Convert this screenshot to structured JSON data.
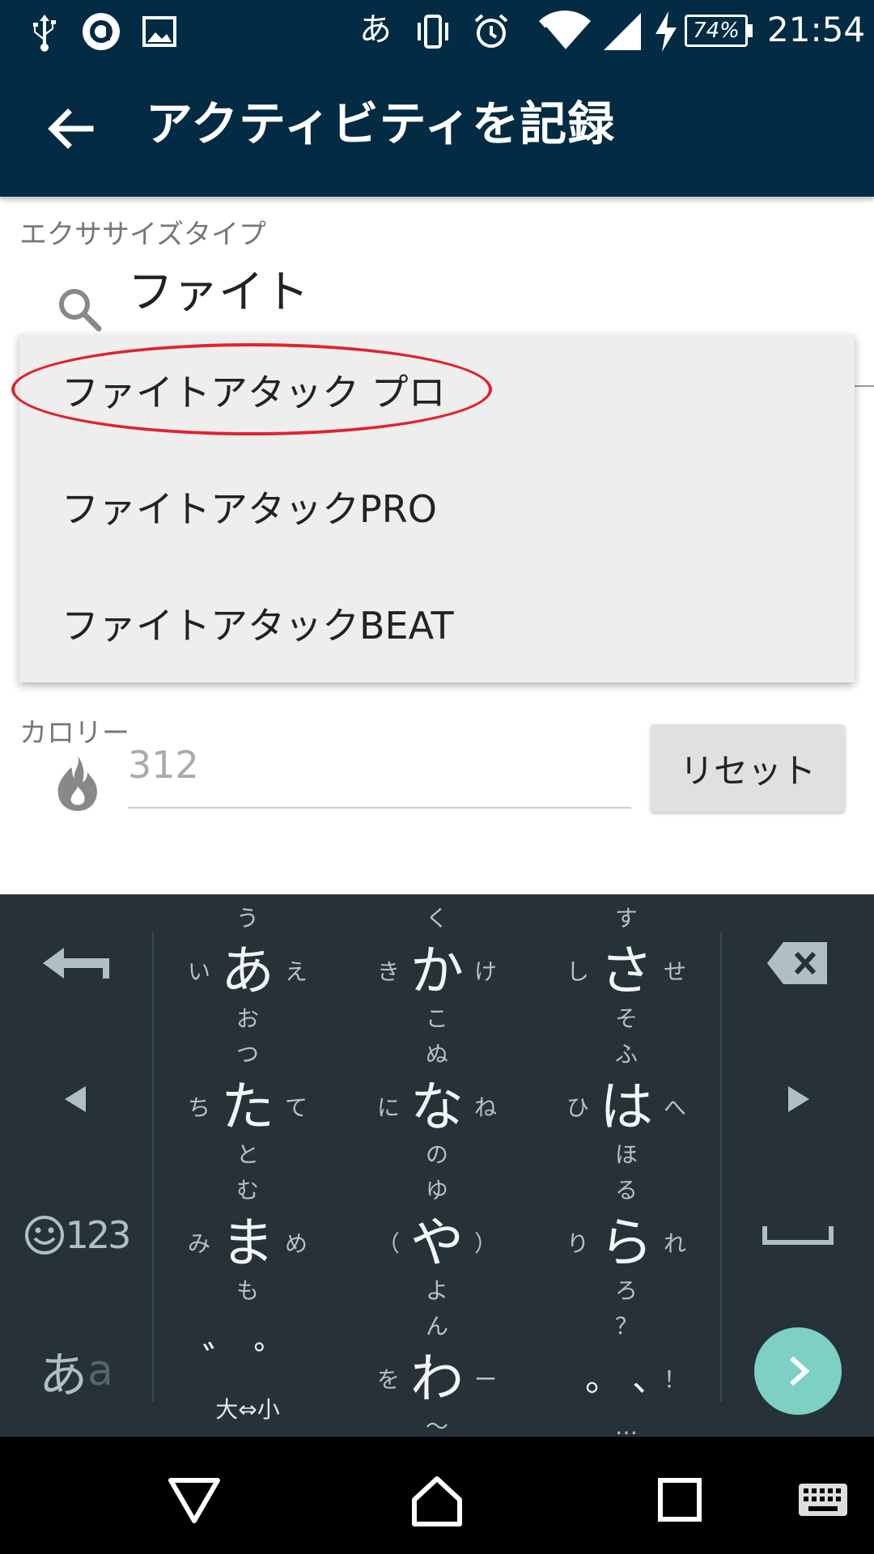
{
  "status_bar": {
    "ime_indicator": "あ",
    "battery": "74%",
    "time": "21:54",
    "icons": [
      "usb-icon",
      "app-notification-icon",
      "image-icon",
      "vibrate-icon",
      "alarm-icon",
      "wifi-icon",
      "signal-icon",
      "charging-icon",
      "battery-icon"
    ]
  },
  "app_bar": {
    "title": "アクティビティを記録",
    "back_icon": "arrow-left-icon"
  },
  "form": {
    "exercise_label": "エクササイズタイプ",
    "exercise_value": "ファイト",
    "suggestions": [
      "ファイトアタック プロ",
      "ファイトアタックPRO",
      "ファイトアタックBEAT"
    ],
    "highlight_color": "#e0232e",
    "calories_label": "カロリー",
    "calories_placeholder": "312",
    "reset_label": "リセット"
  },
  "keyboard": {
    "rows": [
      [
        {
          "c": "あ",
          "u": "う",
          "d": "お",
          "l": "い",
          "r": "え"
        },
        {
          "c": "か",
          "u": "く",
          "d": "こ",
          "l": "き",
          "r": "け"
        },
        {
          "c": "さ",
          "u": "す",
          "d": "そ",
          "l": "し",
          "r": "せ"
        }
      ],
      [
        {
          "c": "た",
          "u": "つ",
          "d": "と",
          "l": "ち",
          "r": "て"
        },
        {
          "c": "な",
          "u": "ぬ",
          "d": "の",
          "l": "に",
          "r": "ね"
        },
        {
          "c": "は",
          "u": "ふ",
          "d": "ほ",
          "l": "ひ",
          "r": "へ"
        }
      ],
      [
        {
          "c": "ま",
          "u": "む",
          "d": "も",
          "l": "み",
          "r": "め"
        },
        {
          "c": "や",
          "u": "ゆ",
          "d": "よ",
          "l": "（",
          "r": "）"
        },
        {
          "c": "ら",
          "u": "る",
          "d": "ろ",
          "l": "り",
          "r": "れ"
        }
      ]
    ],
    "dakuten_label": "゛ ゜",
    "size_toggle_label": "大⇔小",
    "wa_key": {
      "c": "わ",
      "u": "ん",
      "d": "〜",
      "l": "を",
      "r": "ー"
    },
    "punct_key": {
      "c": "。 、",
      "u": "？",
      "d": "…",
      "r": "！"
    },
    "emoji_num_label": "123",
    "mode_main": "あ",
    "mode_sub": "a"
  },
  "colors": {
    "app_bar": "#032b43",
    "keyboard": "#263238",
    "enter": "#7ecfc4"
  }
}
